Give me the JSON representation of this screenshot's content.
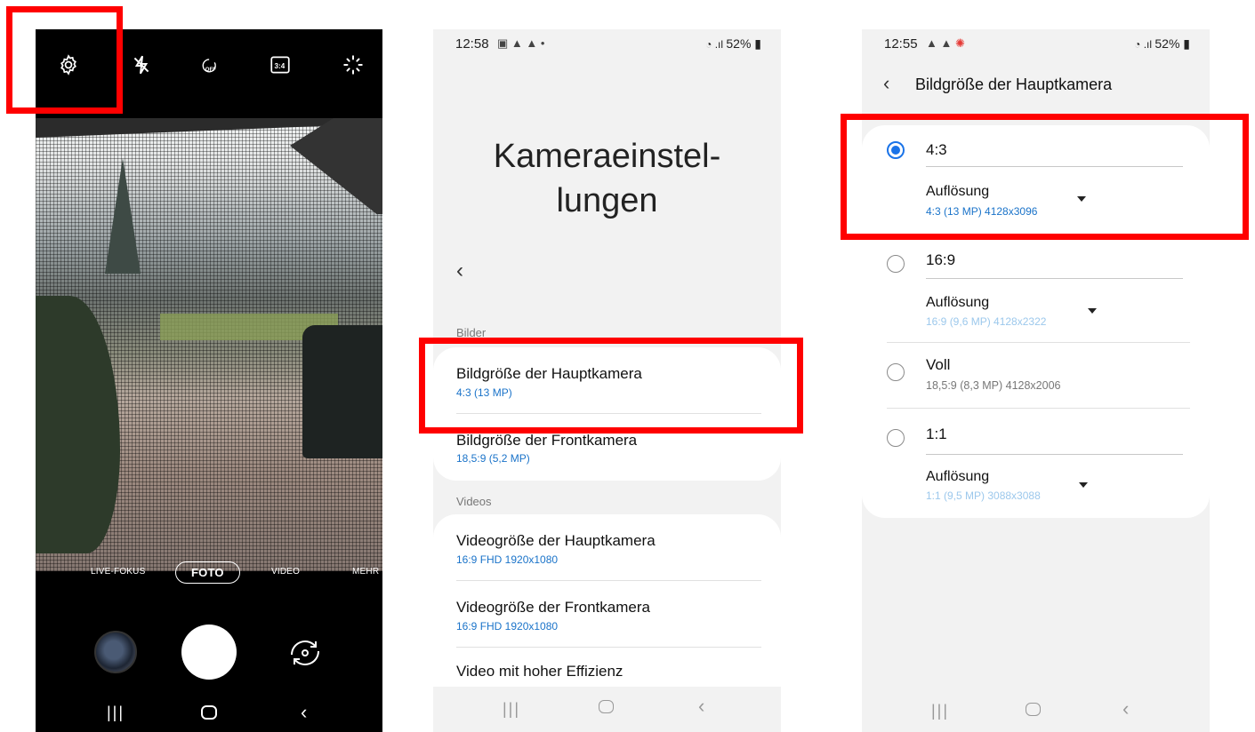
{
  "camera": {
    "top_icons": [
      "settings-icon",
      "flash-off-icon",
      "timer-off-icon",
      "ratio-3-4-icon",
      "effects-icon"
    ],
    "timer_label": "OFF",
    "ratio_label": "3:4",
    "modes": {
      "live_focus": "LIVE-FOKUS",
      "foto": "FOTO",
      "video": "VIDEO",
      "mehr": "MEHR"
    }
  },
  "settings": {
    "status": {
      "time": "12:58",
      "right": "52%"
    },
    "title_line1": "Kameraeinstel-",
    "title_line2": "lungen",
    "section_bilder": "Bilder",
    "items_bilder": [
      {
        "title": "Bildgröße der Hauptkamera",
        "sub": "4:3 (13 MP)"
      },
      {
        "title": "Bildgröße der Frontkamera",
        "sub": "18,5:9 (5,2 MP)"
      }
    ],
    "section_videos": "Videos",
    "items_videos": [
      {
        "title": "Videogröße der Hauptkamera",
        "sub": "16:9 FHD 1920x1080"
      },
      {
        "title": "Videogröße der Frontkamera",
        "sub": "16:9 FHD 1920x1080"
      },
      {
        "title": "Video mit hoher Effizienz",
        "sub": ""
      }
    ]
  },
  "bildgroesse": {
    "status": {
      "time": "12:55",
      "right": "52%"
    },
    "header": "Bildgröße der Hauptkamera",
    "options": [
      {
        "label": "4:3",
        "selected": true,
        "res_label": "Auflösung",
        "res_value": "4:3 (13 MP) 4128x3096"
      },
      {
        "label": "16:9",
        "selected": false,
        "res_label": "Auflösung",
        "res_value": "16:9 (9,6 MP) 4128x2322"
      },
      {
        "label": "Voll",
        "selected": false,
        "res_label": "",
        "res_value": "18,5:9 (8,3 MP) 4128x2006"
      },
      {
        "label": "1:1",
        "selected": false,
        "res_label": "Auflösung",
        "res_value": "1:1 (9,5 MP) 3088x3088"
      }
    ]
  },
  "colors": {
    "highlight": "#ff0000",
    "link_blue": "#1a73c9",
    "faded_blue": "#9cc8ec",
    "radio_blue": "#1a73e8"
  }
}
